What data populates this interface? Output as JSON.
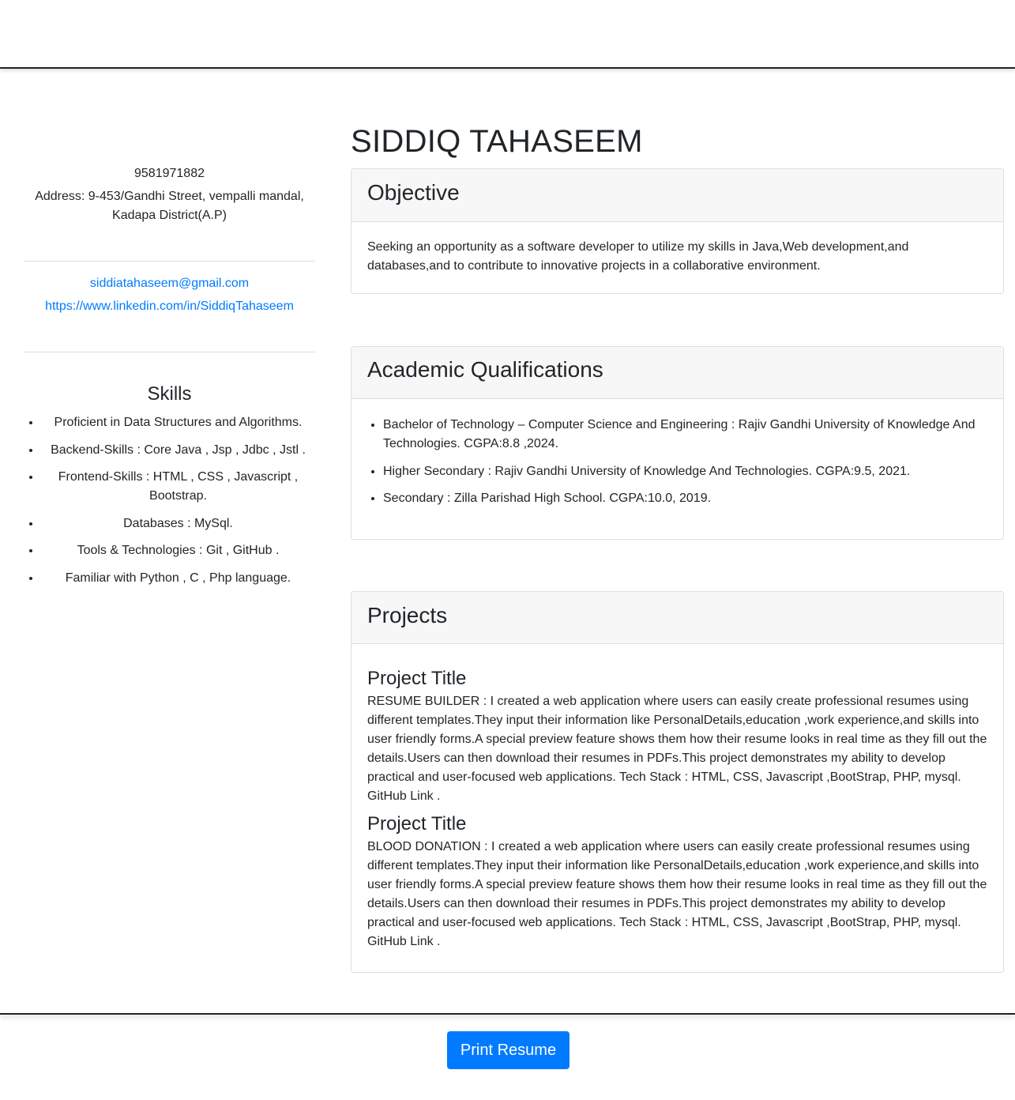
{
  "contact": {
    "phone": "9581971882",
    "address": "Address: 9-453/Gandhi Street, vempalli mandal, Kadapa District(A.P)",
    "email": "siddiatahaseem@gmail.com",
    "linkedin": "https://www.linkedin.com/in/SiddiqTahaseem"
  },
  "skills": {
    "title": "Skills",
    "items": [
      "Proficient in Data Structures and Algorithms.",
      "Backend-Skills : Core Java , Jsp , Jdbc , Jstl .",
      "Frontend-Skills : HTML , CSS , Javascript , Bootstrap.",
      "Databases : MySql.",
      "Tools & Technologies : Git , GitHub .",
      "Familiar with Python , C , Php language."
    ]
  },
  "name": "SIDDIQ TAHASEEM",
  "objective": {
    "title": "Objective",
    "text": "Seeking an opportunity as a software developer to utilize my skills in Java,Web development,and databases,and to contribute to innovative projects in a collaborative environment."
  },
  "academics": {
    "title": "Academic Qualifications",
    "items": [
      "Bachelor of Technology – Computer Science and Engineering : Rajiv Gandhi University of Knowledge And Technologies. CGPA:8.8 ,2024.",
      "Higher Secondary : Rajiv Gandhi University of Knowledge And Technologies. CGPA:9.5, 2021.",
      "Secondary : Zilla Parishad High School. CGPA:10.0, 2019."
    ]
  },
  "projects": {
    "title": "Projects",
    "items": [
      {
        "title": "Project Title",
        "description": "RESUME BUILDER : I created a web application where users can easily create professional resumes using different templates.They input their information like PersonalDetails,education ,work experience,and skills into user friendly forms.A special preview feature shows them how their resume looks in real time as they fill out the details.Users can then download their resumes in PDFs.This project demonstrates my ability to develop practical and user-focused web applications. Tech Stack : HTML, CSS, Javascript ,BootStrap, PHP, mysql. GitHub Link ."
      },
      {
        "title": "Project Title",
        "description": "BLOOD DONATION : I created a web application where users can easily create professional resumes using different templates.They input their information like PersonalDetails,education ,work experience,and skills into user friendly forms.A special preview feature shows them how their resume looks in real time as they fill out the details.Users can then download their resumes in PDFs.This project demonstrates my ability to develop practical and user-focused web applications. Tech Stack : HTML, CSS, Javascript ,BootStrap, PHP, mysql. GitHub Link ."
      }
    ]
  },
  "print_button": "Print Resume",
  "colors": {
    "link": "#007bff",
    "button": "#007bff",
    "card_header": "#f7f7f7"
  }
}
